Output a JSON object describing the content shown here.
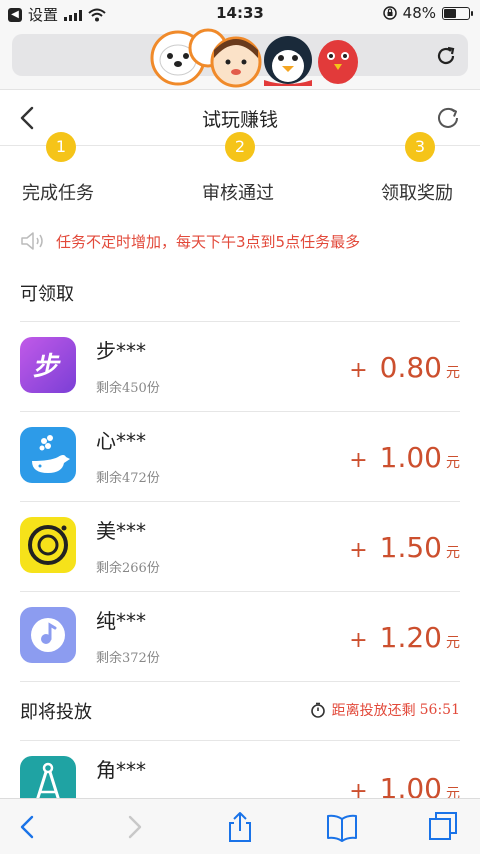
{
  "status_bar": {
    "back_app_label": "设置",
    "time": "14:33",
    "battery_percent": "48%",
    "battery_level": 0.48
  },
  "page": {
    "title": "试玩赚钱"
  },
  "steps": [
    {
      "num": "1",
      "label": "完成任务"
    },
    {
      "num": "2",
      "label": "审核通过"
    },
    {
      "num": "3",
      "label": "领取奖励"
    }
  ],
  "notice": {
    "text": "任务不定时增加，每天下午3点到5点任务最多"
  },
  "available_section": {
    "title": "可领取",
    "items": [
      {
        "name": "步***",
        "stock": "剩余450份",
        "plus": "+",
        "amount": "0.80",
        "unit": "元",
        "icon": "bu-app-icon",
        "color": "#b44ce0"
      },
      {
        "name": "心***",
        "stock": "剩余472份",
        "plus": "+",
        "amount": "1.00",
        "unit": "元",
        "icon": "whale-app-icon",
        "color": "#2d9be8"
      },
      {
        "name": "美***",
        "stock": "剩余266份",
        "plus": "+",
        "amount": "1.50",
        "unit": "元",
        "icon": "camera-app-icon",
        "color": "#f6e21a"
      },
      {
        "name": "纯***",
        "stock": "剩余372份",
        "plus": "+",
        "amount": "1.20",
        "unit": "元",
        "icon": "music-app-icon",
        "color": "#8c9cf0"
      }
    ]
  },
  "upcoming_section": {
    "title": "即将投放",
    "countdown_label": "距离投放还剩",
    "countdown_value": "56:51",
    "items": [
      {
        "name": "角***",
        "stock": "",
        "plus": "+",
        "amount": "1.00",
        "unit": "元",
        "icon": "compass-app-icon",
        "color": "#1fa3a3"
      }
    ]
  },
  "colors": {
    "accent_red": "#cc4f2e",
    "notice_red": "#e24a3b",
    "step_yellow": "#f5c419"
  }
}
